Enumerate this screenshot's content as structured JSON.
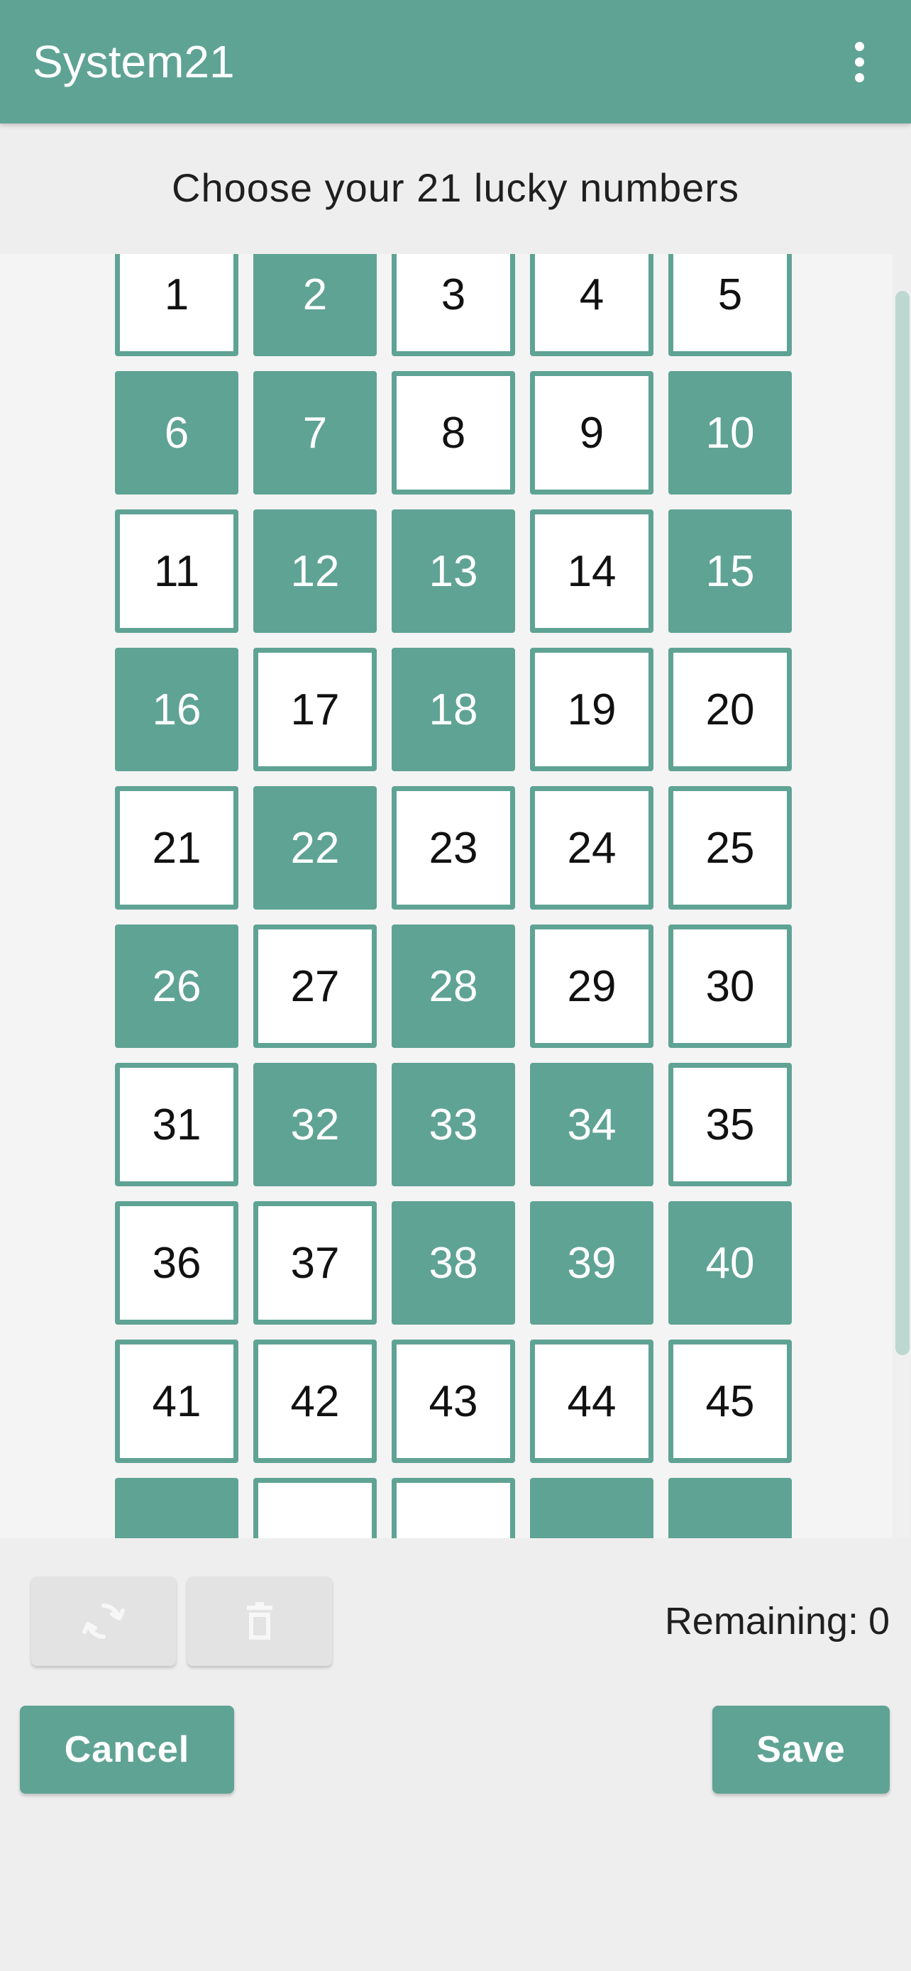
{
  "app": {
    "title": "System21"
  },
  "header": {
    "subtitle": "Choose your 21 lucky numbers"
  },
  "grid": {
    "numbers": [
      {
        "label": "1",
        "selected": false
      },
      {
        "label": "2",
        "selected": true
      },
      {
        "label": "3",
        "selected": false
      },
      {
        "label": "4",
        "selected": false
      },
      {
        "label": "5",
        "selected": false
      },
      {
        "label": "6",
        "selected": true
      },
      {
        "label": "7",
        "selected": true
      },
      {
        "label": "8",
        "selected": false
      },
      {
        "label": "9",
        "selected": false
      },
      {
        "label": "10",
        "selected": true
      },
      {
        "label": "11",
        "selected": false
      },
      {
        "label": "12",
        "selected": true
      },
      {
        "label": "13",
        "selected": true
      },
      {
        "label": "14",
        "selected": false
      },
      {
        "label": "15",
        "selected": true
      },
      {
        "label": "16",
        "selected": true
      },
      {
        "label": "17",
        "selected": false
      },
      {
        "label": "18",
        "selected": true
      },
      {
        "label": "19",
        "selected": false
      },
      {
        "label": "20",
        "selected": false
      },
      {
        "label": "21",
        "selected": false
      },
      {
        "label": "22",
        "selected": true
      },
      {
        "label": "23",
        "selected": false
      },
      {
        "label": "24",
        "selected": false
      },
      {
        "label": "25",
        "selected": false
      },
      {
        "label": "26",
        "selected": true
      },
      {
        "label": "27",
        "selected": false
      },
      {
        "label": "28",
        "selected": true
      },
      {
        "label": "29",
        "selected": false
      },
      {
        "label": "30",
        "selected": false
      },
      {
        "label": "31",
        "selected": false
      },
      {
        "label": "32",
        "selected": true
      },
      {
        "label": "33",
        "selected": true
      },
      {
        "label": "34",
        "selected": true
      },
      {
        "label": "35",
        "selected": false
      },
      {
        "label": "36",
        "selected": false
      },
      {
        "label": "37",
        "selected": false
      },
      {
        "label": "38",
        "selected": true
      },
      {
        "label": "39",
        "selected": true
      },
      {
        "label": "40",
        "selected": true
      },
      {
        "label": "41",
        "selected": false
      },
      {
        "label": "42",
        "selected": false
      },
      {
        "label": "43",
        "selected": false
      },
      {
        "label": "44",
        "selected": false
      },
      {
        "label": "45",
        "selected": false
      },
      {
        "label": "",
        "selected": true
      },
      {
        "label": "",
        "selected": false
      },
      {
        "label": "",
        "selected": false
      },
      {
        "label": "",
        "selected": true
      },
      {
        "label": "",
        "selected": true
      }
    ]
  },
  "toolbar": {
    "refresh_icon": "refresh-icon",
    "delete_icon": "trash-icon"
  },
  "status": {
    "remaining_label": "Remaining:",
    "remaining_value": "0"
  },
  "actions": {
    "cancel_label": "Cancel",
    "save_label": "Save"
  },
  "colors": {
    "accent": "#5fa394",
    "tool_icon": "#f7f7f7"
  }
}
